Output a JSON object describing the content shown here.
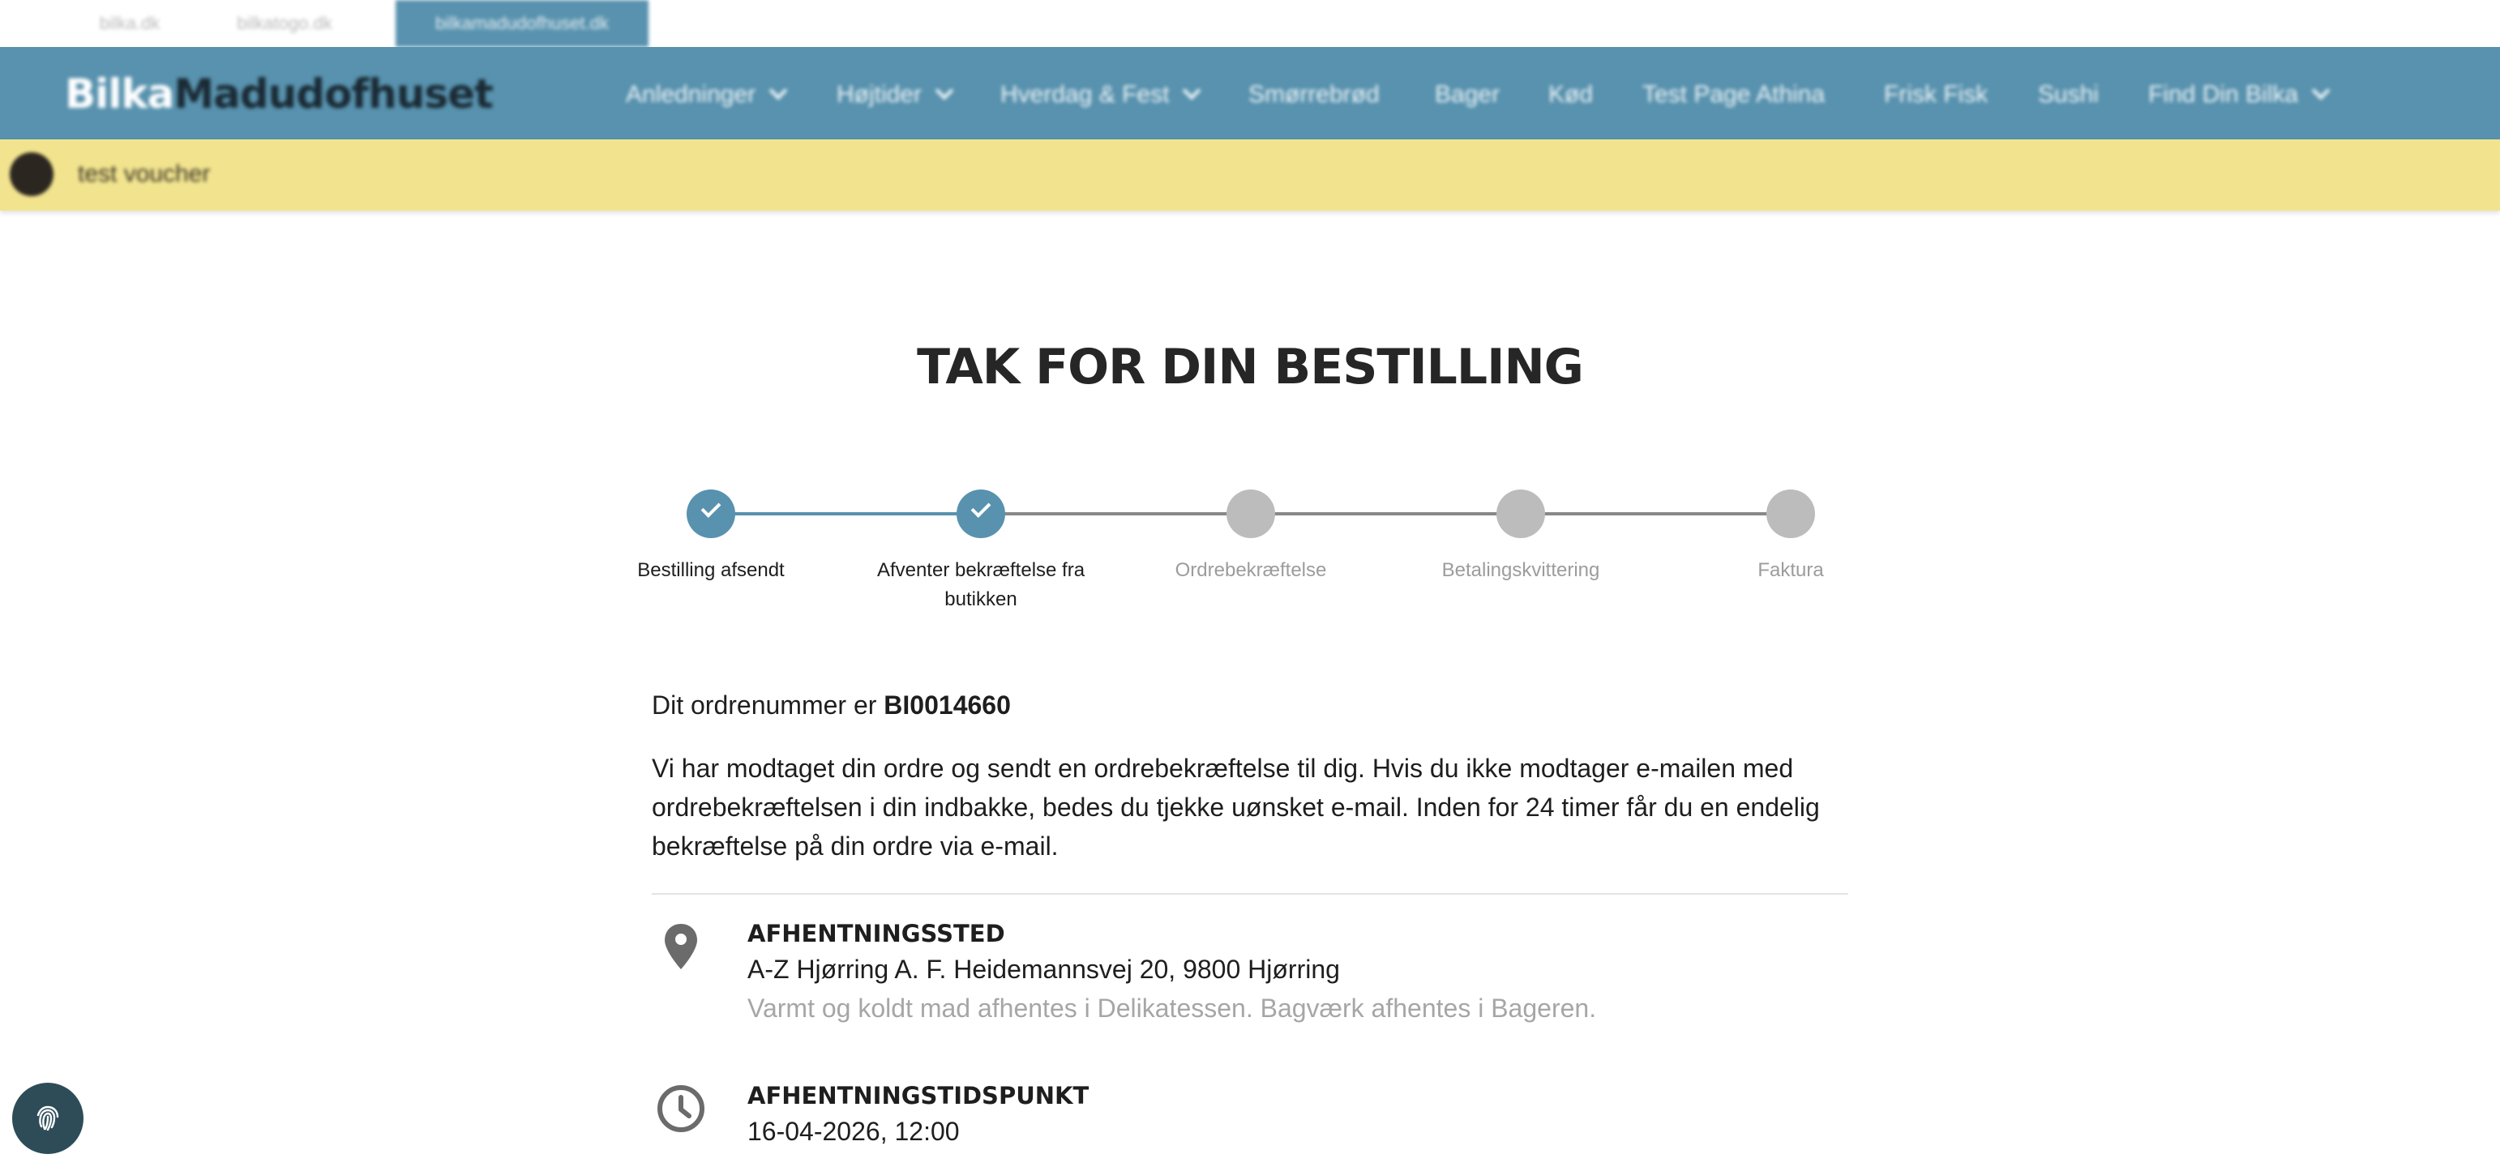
{
  "site_tabs": [
    {
      "label": "bilka.dk"
    },
    {
      "label": "bilkatogo.dk"
    },
    {
      "label": "bilkamadudofhuset.dk"
    }
  ],
  "header": {
    "logo_part1": "Bilka",
    "logo_part2": "Madudofhuset",
    "nav": [
      {
        "label": "Anledninger",
        "dropdown": true
      },
      {
        "label": "Højtider",
        "dropdown": true
      },
      {
        "label": "Hverdag & Fest",
        "dropdown": true
      },
      {
        "label": "Smørrebrød",
        "dropdown": false
      },
      {
        "label": "Bager",
        "dropdown": false
      },
      {
        "label": "Kød",
        "dropdown": false
      },
      {
        "label": "Test Page Athina",
        "dropdown": false
      },
      {
        "label": "Frisk Fisk",
        "dropdown": false
      },
      {
        "label": "Sushi",
        "dropdown": false
      },
      {
        "label": "Find Din Bilka",
        "dropdown": true
      }
    ],
    "colors": {
      "header_bg": "#5892ae",
      "voucher_bg": "#f2e48f"
    }
  },
  "voucher": {
    "text": "test voucher"
  },
  "page": {
    "title": "TAK FOR DIN BESTILLING"
  },
  "stepper": {
    "steps": [
      {
        "label": "Bestilling afsendt",
        "status": "done"
      },
      {
        "label": "Afventer bekræftelse fra butikken",
        "status": "done"
      },
      {
        "label": "Ordrebekræftelse",
        "status": "pending"
      },
      {
        "label": "Betalingskvittering",
        "status": "pending"
      },
      {
        "label": "Faktura",
        "status": "pending"
      }
    ],
    "colors": {
      "done": "#5892ae",
      "pending": "#bcbcbc"
    }
  },
  "order": {
    "number_prefix": "Dit ordrenummer er",
    "number": "BI0014660",
    "description": "Vi har modtaget din ordre og sendt en ordrebekræftelse til dig. Hvis du ikke modtager e-mailen med ordrebekræftelsen i din indbakke, bedes du tjekke uønsket e-mail. Inden for 24 timer får du en endelig bekræftelse på din ordre via e-mail."
  },
  "pickup_location": {
    "icon": "location-pin-icon",
    "heading": "AFHENTNINGSSTED",
    "address": "A-Z Hjørring A. F. Heidemannsvej 20, 9800 Hjørring",
    "note": "Varmt og koldt mad afhentes i Delikatessen. Bagværk afhentes i Bageren."
  },
  "pickup_time": {
    "icon": "clock-icon",
    "heading": "AFHENTNINGSTIDSPUNKT",
    "value": "16-04-2026, 12:00"
  },
  "floating_button": {
    "icon": "fingerprint-icon"
  }
}
